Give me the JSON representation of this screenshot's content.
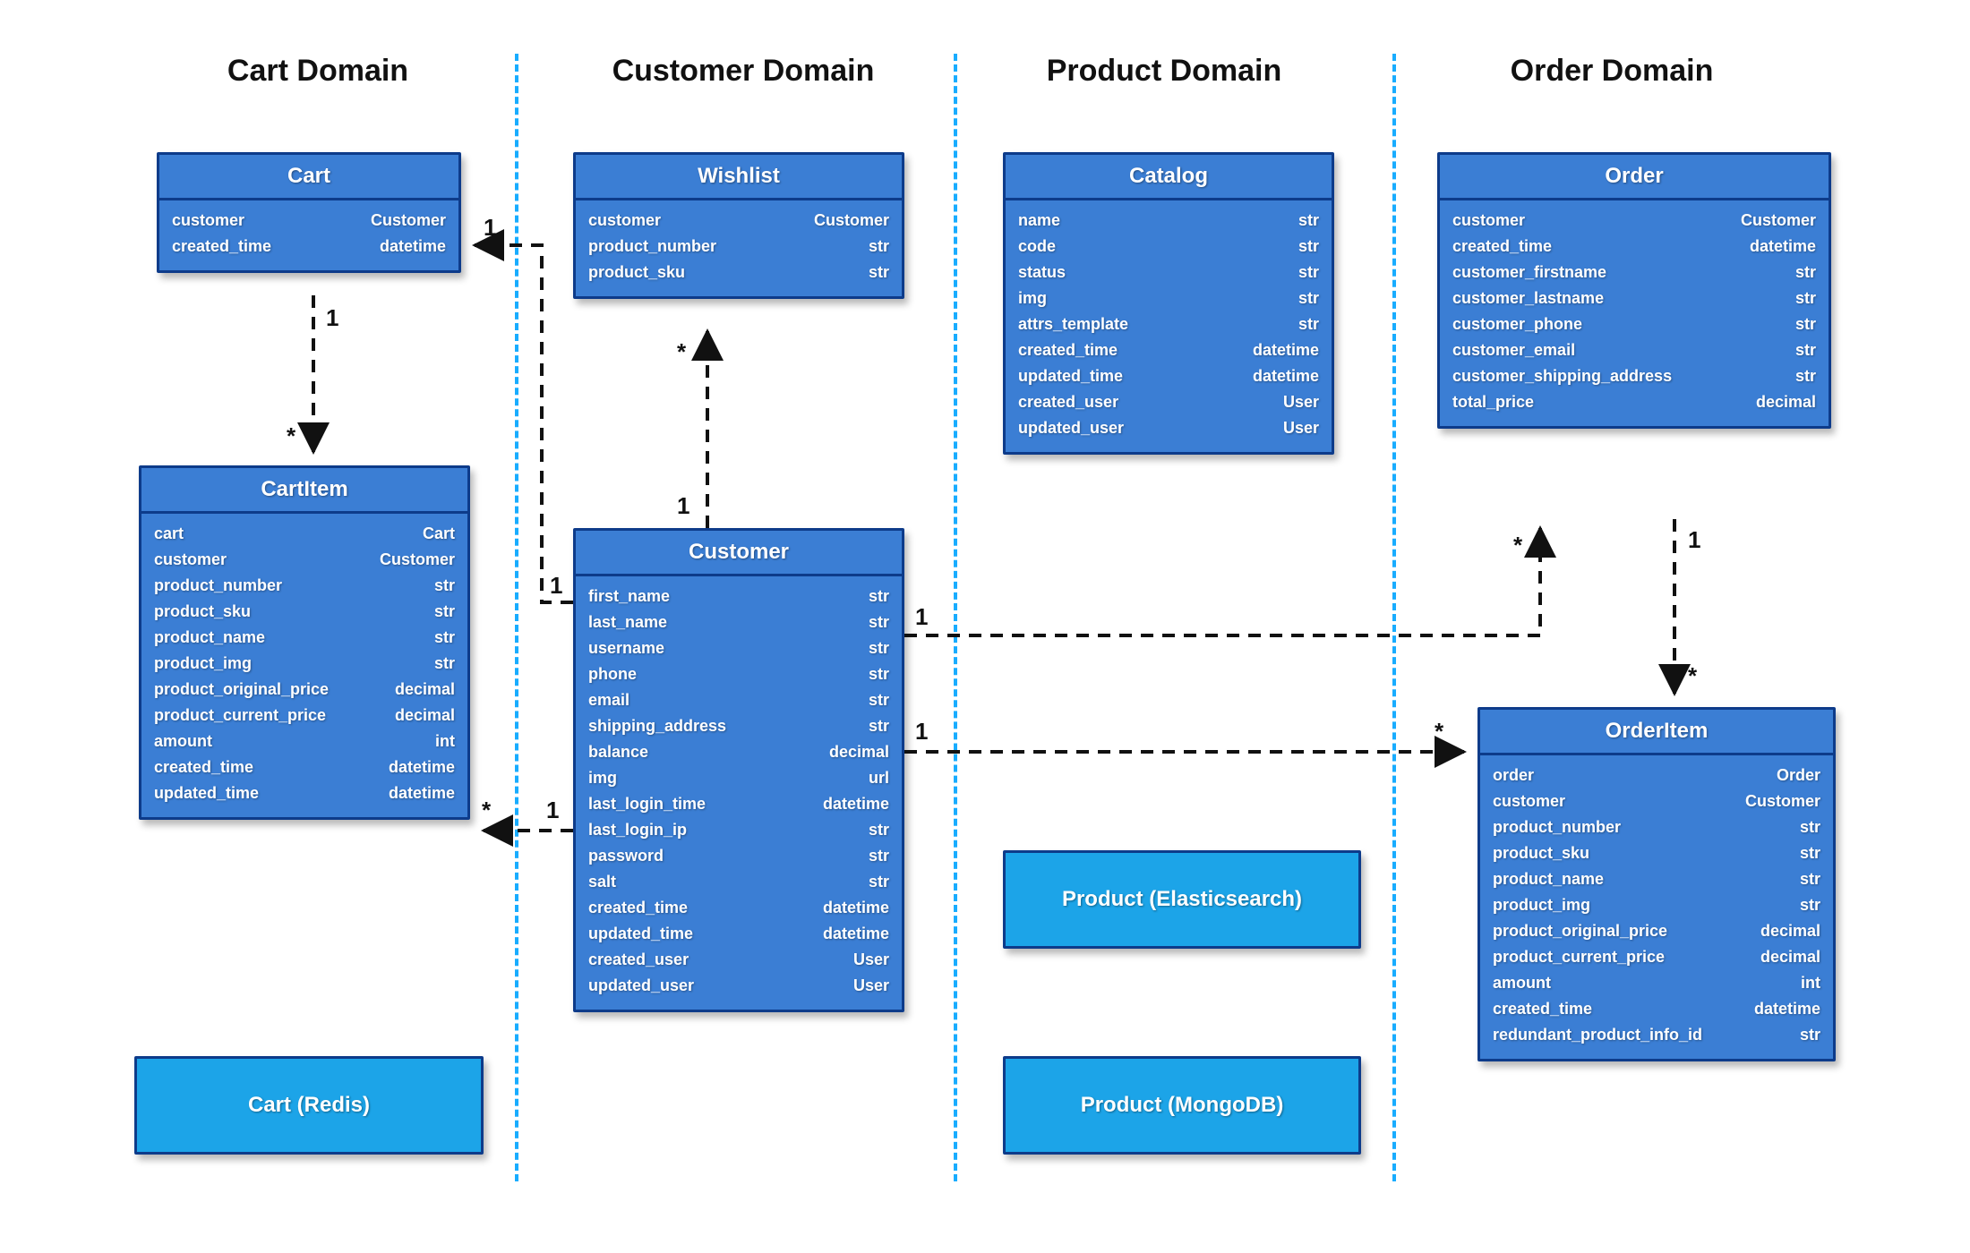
{
  "domains": {
    "cart": {
      "title": "Cart Domain"
    },
    "customer": {
      "title": "Customer Domain"
    },
    "product": {
      "title": "Product Domain"
    },
    "order": {
      "title": "Order Domain"
    }
  },
  "entities": {
    "cart": {
      "name": "Cart",
      "fields": [
        {
          "name": "customer",
          "type": "Customer"
        },
        {
          "name": "created_time",
          "type": "datetime"
        }
      ]
    },
    "cart_item": {
      "name": "CartItem",
      "fields": [
        {
          "name": "cart",
          "type": "Cart"
        },
        {
          "name": "customer",
          "type": "Customer"
        },
        {
          "name": "product_number",
          "type": "str"
        },
        {
          "name": "product_sku",
          "type": "str"
        },
        {
          "name": "product_name",
          "type": "str"
        },
        {
          "name": "product_img",
          "type": "str"
        },
        {
          "name": "product_original_price",
          "type": "decimal"
        },
        {
          "name": "product_current_price",
          "type": "decimal"
        },
        {
          "name": "amount",
          "type": "int"
        },
        {
          "name": "created_time",
          "type": "datetime"
        },
        {
          "name": "updated_time",
          "type": "datetime"
        }
      ]
    },
    "wishlist": {
      "name": "Wishlist",
      "fields": [
        {
          "name": "customer",
          "type": "Customer"
        },
        {
          "name": "product_number",
          "type": "str"
        },
        {
          "name": "product_sku",
          "type": "str"
        }
      ]
    },
    "customer": {
      "name": "Customer",
      "fields": [
        {
          "name": "first_name",
          "type": "str"
        },
        {
          "name": "last_name",
          "type": "str"
        },
        {
          "name": "username",
          "type": "str"
        },
        {
          "name": "phone",
          "type": "str"
        },
        {
          "name": "email",
          "type": "str"
        },
        {
          "name": "shipping_address",
          "type": "str"
        },
        {
          "name": "balance",
          "type": "decimal"
        },
        {
          "name": "img",
          "type": "url"
        },
        {
          "name": "last_login_time",
          "type": "datetime"
        },
        {
          "name": "last_login_ip",
          "type": "str"
        },
        {
          "name": "password",
          "type": "str"
        },
        {
          "name": "salt",
          "type": "str"
        },
        {
          "name": "created_time",
          "type": "datetime"
        },
        {
          "name": "updated_time",
          "type": "datetime"
        },
        {
          "name": "created_user",
          "type": "User"
        },
        {
          "name": "updated_user",
          "type": "User"
        }
      ]
    },
    "catalog": {
      "name": "Catalog",
      "fields": [
        {
          "name": "name",
          "type": "str"
        },
        {
          "name": "code",
          "type": "str"
        },
        {
          "name": "status",
          "type": "str"
        },
        {
          "name": "img",
          "type": "str"
        },
        {
          "name": "attrs_template",
          "type": "str"
        },
        {
          "name": "created_time",
          "type": "datetime"
        },
        {
          "name": "updated_time",
          "type": "datetime"
        },
        {
          "name": "created_user",
          "type": "User"
        },
        {
          "name": "updated_user",
          "type": "User"
        }
      ]
    },
    "order": {
      "name": "Order",
      "fields": [
        {
          "name": "customer",
          "type": "Customer"
        },
        {
          "name": "created_time",
          "type": "datetime"
        },
        {
          "name": "customer_firstname",
          "type": "str"
        },
        {
          "name": "customer_lastname",
          "type": "str"
        },
        {
          "name": "customer_phone",
          "type": "str"
        },
        {
          "name": "customer_email",
          "type": "str"
        },
        {
          "name": "customer_shipping_address",
          "type": "str"
        },
        {
          "name": "total_price",
          "type": "decimal"
        }
      ]
    },
    "order_item": {
      "name": "OrderItem",
      "fields": [
        {
          "name": "order",
          "type": "Order"
        },
        {
          "name": "customer",
          "type": "Customer"
        },
        {
          "name": "product_number",
          "type": "str"
        },
        {
          "name": "product_sku",
          "type": "str"
        },
        {
          "name": "product_name",
          "type": "str"
        },
        {
          "name": "product_img",
          "type": "str"
        },
        {
          "name": "product_original_price",
          "type": "decimal"
        },
        {
          "name": "product_current_price",
          "type": "decimal"
        },
        {
          "name": "amount",
          "type": "int"
        },
        {
          "name": "created_time",
          "type": "datetime"
        },
        {
          "name": "redundant_product_info_id",
          "type": "str"
        }
      ]
    }
  },
  "stores": {
    "cart_redis": {
      "label": "Cart (Redis)"
    },
    "product_es": {
      "label": "Product (Elasticsearch)"
    },
    "product_mgo": {
      "label": "Product (MongoDB)"
    }
  },
  "relations": {
    "cart_to_cartitem": {
      "from": "1",
      "to": "*"
    },
    "customer_to_cart": {
      "from": "1",
      "to": "1"
    },
    "customer_to_wishlist": {
      "from": "1",
      "to": "*"
    },
    "customer_to_cartitem": {
      "from": "1",
      "to": "*"
    },
    "customer_to_order": {
      "from": "1",
      "to": "*"
    },
    "customer_to_orderitem": {
      "from": "1",
      "to": "*"
    },
    "order_to_orderitem": {
      "from": "1",
      "to": "*"
    }
  }
}
